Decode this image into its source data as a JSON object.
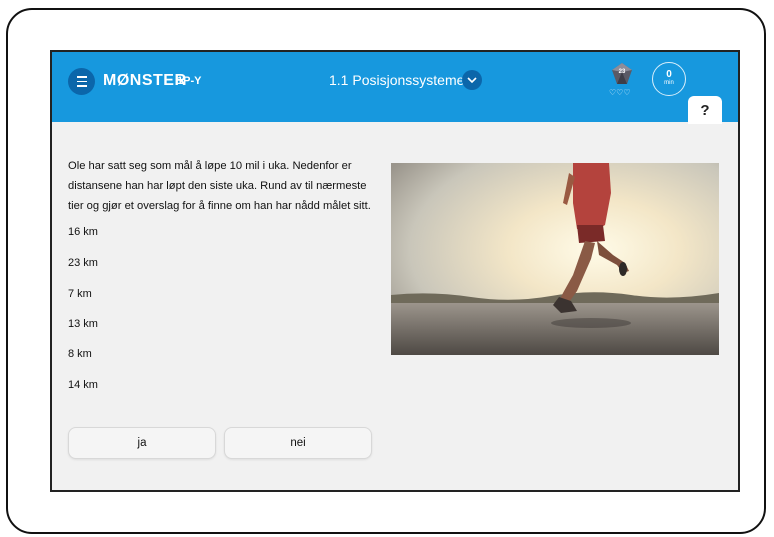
{
  "header": {
    "brand": "MØNSTER",
    "brand_sub": "1P-Y",
    "topic": "1.1 Posisjonssystemet",
    "gem_count": "23",
    "hearts": "♡♡♡",
    "timer_value": "0",
    "timer_unit": "min",
    "help_label": "?"
  },
  "question": {
    "text": "Ole har satt seg som mål å løpe 10 mil i uka. Nedenfor er distansene han har løpt den siste uka. Rund av til nærmeste tier og gjør et overslag for å finne om han har nådd målet sitt.",
    "distances": [
      "16 km",
      "23 km",
      "7 km",
      "13 km",
      "8 km",
      "14 km"
    ]
  },
  "answers": {
    "yes_label": "ja",
    "no_label": "nei"
  },
  "icons": {
    "menu": "menu-icon",
    "chevron": "chevron-down-icon",
    "gem": "gem-icon",
    "timer": "timer-icon"
  },
  "colors": {
    "header": "#1798de",
    "header_dark": "#0b66aa",
    "background": "#f1f1f1"
  }
}
